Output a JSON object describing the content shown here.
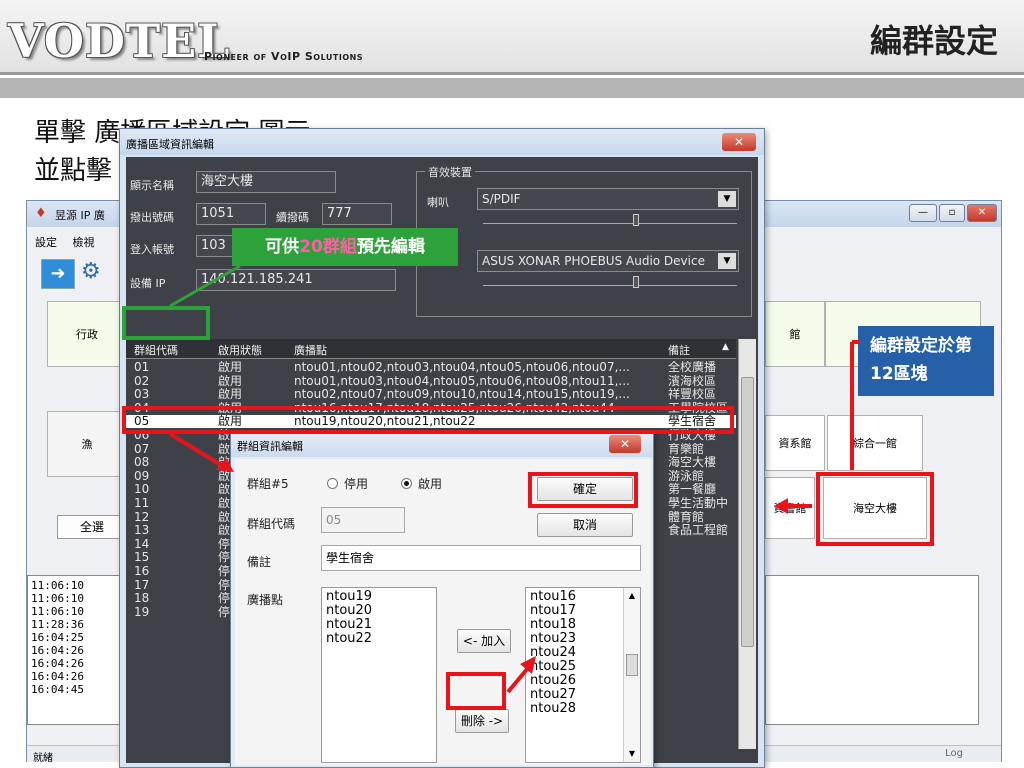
{
  "slide": {
    "logo": "VODTEL",
    "tagline": "Pioneer of VoIP Solutions",
    "title": "編群設定",
    "bullet1": "單擊 廣播區域設定 圖示",
    "bullet2": "並點擊"
  },
  "app": {
    "title": "昱源 IP 廣",
    "menu": [
      "設定",
      "檢視"
    ],
    "zones": [
      "行政",
      "漁",
      "館",
      "資系館",
      "綜合一館",
      "海空大樓",
      "資書館"
    ],
    "select_all": "全選",
    "log_lines": [
      "11:06:10",
      "11:06:10",
      "11:06:10",
      "11:28:36",
      "16:04:25",
      "16:04:26",
      "16:04:26",
      "16:04:26",
      "16:04:45"
    ],
    "status": "就緒",
    "status_right": "Log",
    "edit_label": "編輯"
  },
  "area_dialog": {
    "title": "廣播區域資訊編輯",
    "display_name_label": "顯示名稱",
    "display_name": "海空大樓",
    "dial_out_label": "撥出號碼",
    "dial_out": "1051",
    "ext_label": "續撥碼",
    "ext": "777",
    "login_label": "登入帳號",
    "login": "103",
    "ip_label": "設備 IP",
    "ip": "140.121.185.241",
    "fx_group": "音效裝置",
    "speaker_label": "喇叭",
    "speaker": "S/PDIF",
    "device": "ASUS XONAR PHOEBUS Audio Device",
    "columns": [
      "群組代碼",
      "啟用狀態",
      "廣播點",
      "備註"
    ],
    "rows": [
      {
        "code": "01",
        "state": "啟用",
        "points": "ntou01,ntou02,ntou03,ntou04,ntou05,ntou06,ntou07,...",
        "note": "全校廣播"
      },
      {
        "code": "02",
        "state": "啟用",
        "points": "ntou01,ntou03,ntou04,ntou05,ntou06,ntou08,ntou11,...",
        "note": "濱海校區"
      },
      {
        "code": "03",
        "state": "啟用",
        "points": "ntou02,ntou07,ntou09,ntou10,ntou14,ntou15,ntou19,...",
        "note": "祥豐校區"
      },
      {
        "code": "04",
        "state": "啟用",
        "points": "ntou16,ntou17,ntou18,ntou25,ntou26,ntou42,ntou44",
        "note": "工學院校區"
      },
      {
        "code": "05",
        "state": "啟用",
        "points": "ntou19,ntou20,ntou21,ntou22",
        "note": "學生宿舍"
      },
      {
        "code": "06",
        "state": "啟",
        "points": "",
        "note": "行政大樓"
      },
      {
        "code": "07",
        "state": "啟",
        "points": "",
        "note": "育樂館"
      },
      {
        "code": "08",
        "state": "啟",
        "points": "",
        "note": "海空大樓"
      },
      {
        "code": "09",
        "state": "啟",
        "points": "",
        "note": "游泳館"
      },
      {
        "code": "10",
        "state": "啟",
        "points": "",
        "note": "第一餐廳"
      },
      {
        "code": "11",
        "state": "啟",
        "points": "",
        "note": "學生活動中"
      },
      {
        "code": "12",
        "state": "啟",
        "points": "",
        "note": "體育館"
      },
      {
        "code": "13",
        "state": "啟",
        "points": "",
        "note": "食品工程館"
      },
      {
        "code": "14",
        "state": "停",
        "points": "",
        "note": ""
      },
      {
        "code": "15",
        "state": "停",
        "points": "",
        "note": ""
      },
      {
        "code": "16",
        "state": "停",
        "points": "",
        "note": ""
      },
      {
        "code": "17",
        "state": "停",
        "points": "",
        "note": ""
      },
      {
        "code": "18",
        "state": "停",
        "points": "",
        "note": ""
      },
      {
        "code": "19",
        "state": "停",
        "points": "",
        "note": ""
      }
    ]
  },
  "group_dialog": {
    "title": "群組資訊編輯",
    "group_label": "群組#5",
    "disable": "停用",
    "enable": "啟用",
    "code_label": "群組代碼",
    "code": "05",
    "note_label": "備註",
    "note": "學生宿舍",
    "points_label": "廣播點",
    "ok": "確定",
    "cancel": "取消",
    "add": "<- 加入",
    "remove": "刪除 ->",
    "selected": [
      "ntou19",
      "ntou20",
      "ntou21",
      "ntou22"
    ],
    "available": [
      "ntou16",
      "ntou17",
      "ntou18",
      "ntou23",
      "ntou24",
      "ntou25",
      "ntou26",
      "ntou27",
      "ntou28"
    ]
  },
  "annotations": {
    "green_pre": "可供",
    "green_hl": "20群組",
    "green_post": "預先編輯",
    "blue": "編群設定於第12區塊",
    "red": "#e8141c",
    "green": "#2ea23a",
    "blue_bg": "#2560a8"
  }
}
